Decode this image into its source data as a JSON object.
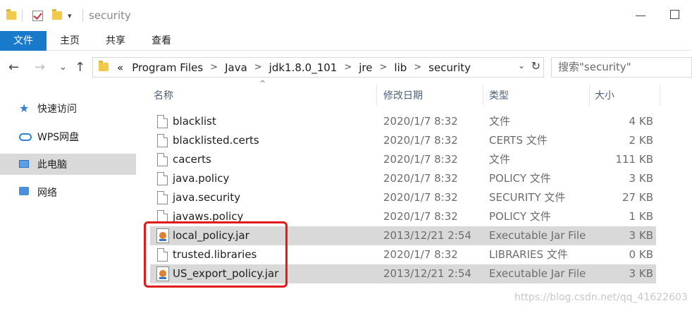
{
  "window": {
    "title": "security"
  },
  "ribbon": {
    "tabs": [
      {
        "label": "文件",
        "active": true
      },
      {
        "label": "主页",
        "active": false
      },
      {
        "label": "共享",
        "active": false
      },
      {
        "label": "查看",
        "active": false
      }
    ]
  },
  "address": {
    "overflow": "«",
    "crumbs": [
      "Program Files",
      "Java",
      "jdk1.8.0_101",
      "jre",
      "lib",
      "security"
    ],
    "search_placeholder": "搜索\"security\""
  },
  "nav_pane": {
    "items": [
      {
        "label": "快速访问",
        "icon": "star-icon",
        "selected": false
      },
      {
        "label": "WPS网盘",
        "icon": "cloud-icon",
        "selected": false
      },
      {
        "label": "此电脑",
        "icon": "computer-icon",
        "selected": true
      },
      {
        "label": "网络",
        "icon": "network-icon",
        "selected": false
      }
    ]
  },
  "columns": {
    "name": "名称",
    "date": "修改日期",
    "type": "类型",
    "size": "大小"
  },
  "files": [
    {
      "name": "blacklist",
      "date": "2020/1/7 8:32",
      "type": "文件",
      "size": "4 KB",
      "icon": "file",
      "highlighted": false
    },
    {
      "name": "blacklisted.certs",
      "date": "2020/1/7 8:32",
      "type": "CERTS 文件",
      "size": "2 KB",
      "icon": "file",
      "highlighted": false
    },
    {
      "name": "cacerts",
      "date": "2020/1/7 8:32",
      "type": "文件",
      "size": "111 KB",
      "icon": "file",
      "highlighted": false
    },
    {
      "name": "java.policy",
      "date": "2020/1/7 8:32",
      "type": "POLICY 文件",
      "size": "3 KB",
      "icon": "file",
      "highlighted": false
    },
    {
      "name": "java.security",
      "date": "2020/1/7 8:32",
      "type": "SECURITY 文件",
      "size": "27 KB",
      "icon": "file",
      "highlighted": false
    },
    {
      "name": "javaws.policy",
      "date": "2020/1/7 8:32",
      "type": "POLICY 文件",
      "size": "1 KB",
      "icon": "file",
      "highlighted": false
    },
    {
      "name": "local_policy.jar",
      "date": "2013/12/21 2:54",
      "type": "Executable Jar File",
      "size": "3 KB",
      "icon": "jar",
      "highlighted": true
    },
    {
      "name": "trusted.libraries",
      "date": "2020/1/7 8:32",
      "type": "LIBRARIES 文件",
      "size": "0 KB",
      "icon": "file",
      "highlighted": false
    },
    {
      "name": "US_export_policy.jar",
      "date": "2013/12/21 2:54",
      "type": "Executable Jar File",
      "size": "3 KB",
      "icon": "jar",
      "highlighted": true
    }
  ],
  "watermark": "https://blog.csdn.net/qq_41622603",
  "colors": {
    "accent": "#1979ca",
    "highlight_box": "#e11a1a",
    "row_highlight": "#d9d9d9"
  }
}
